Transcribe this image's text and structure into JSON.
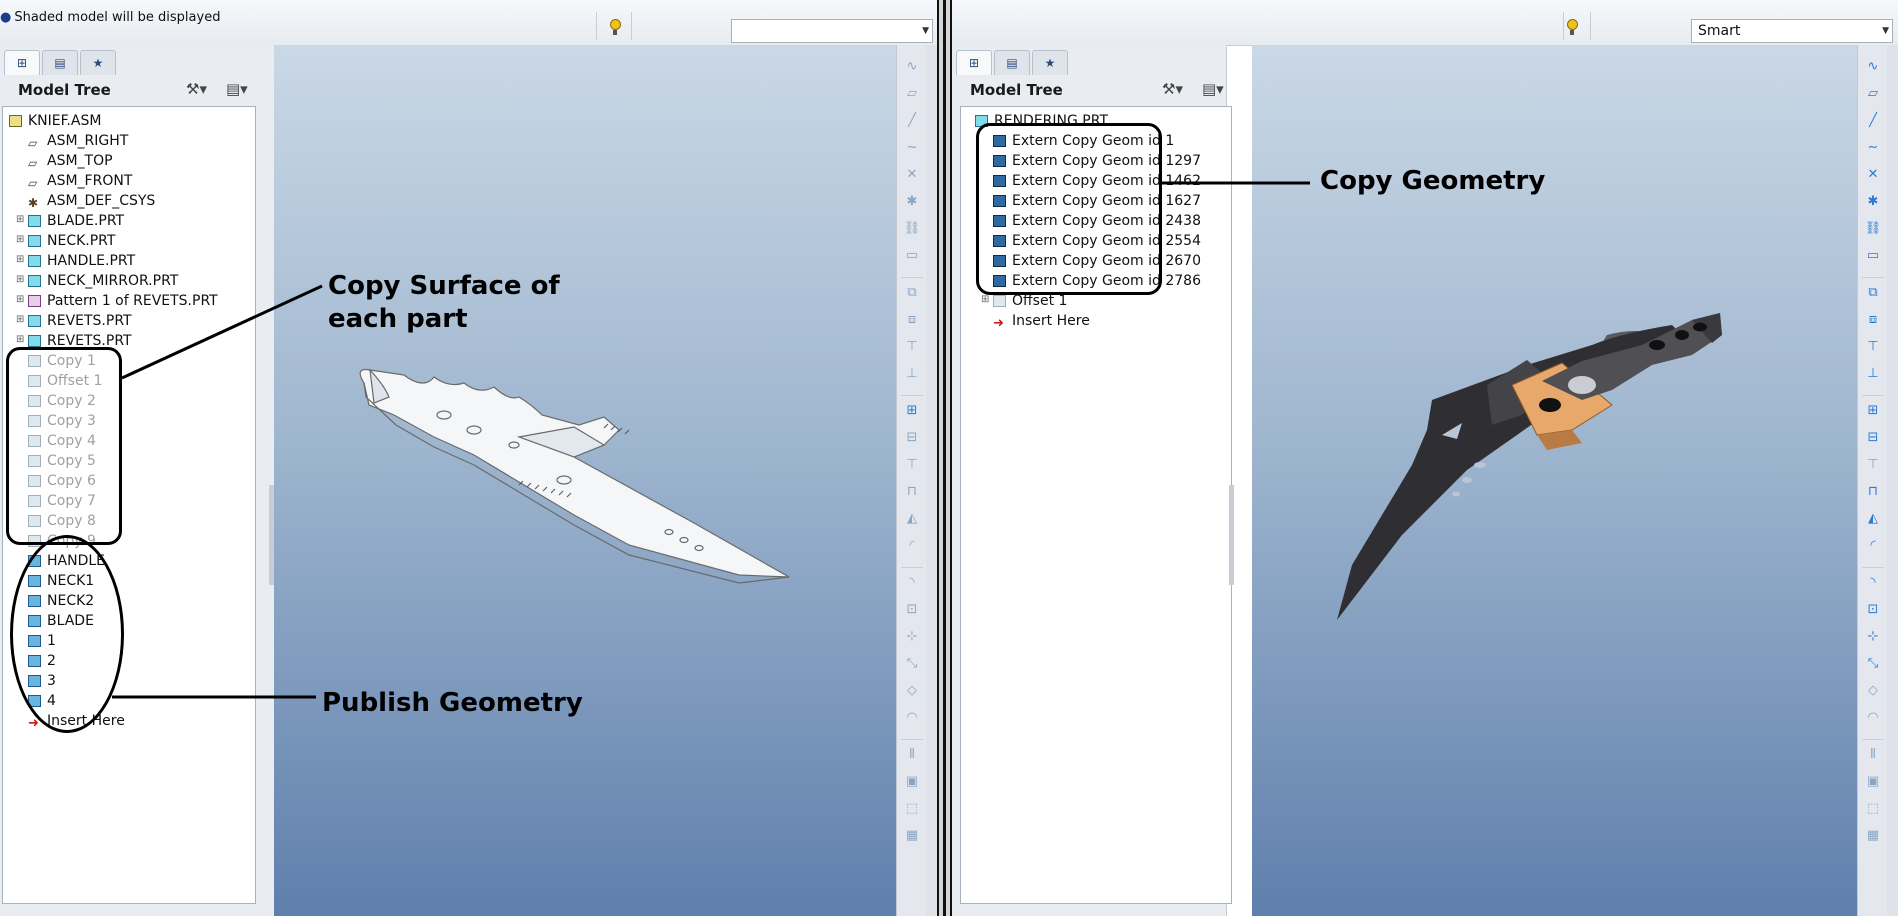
{
  "left": {
    "status_message": "Shaded model will be displayed",
    "display_select_value": "",
    "tree_title": "Model Tree",
    "tree_items": [
      {
        "label": "KNIEF.ASM",
        "icon": "assembly-icon",
        "style": "normal"
      },
      {
        "label": "ASM_RIGHT",
        "icon": "datum-plane-icon",
        "style": "normal"
      },
      {
        "label": "ASM_TOP",
        "icon": "datum-plane-icon",
        "style": "normal"
      },
      {
        "label": "ASM_FRONT",
        "icon": "datum-plane-icon",
        "style": "normal"
      },
      {
        "label": "ASM_DEF_CSYS",
        "icon": "coordinate-system-icon",
        "style": "normal"
      },
      {
        "label": "BLADE.PRT",
        "icon": "part-icon",
        "style": "normal"
      },
      {
        "label": "NECK.PRT",
        "icon": "part-icon",
        "style": "normal"
      },
      {
        "label": "HANDLE.PRT",
        "icon": "part-icon",
        "style": "normal"
      },
      {
        "label": "NECK_MIRROR.PRT",
        "icon": "part-icon",
        "style": "normal"
      },
      {
        "label": "Pattern 1 of REVETS.PRT",
        "icon": "pattern-icon",
        "style": "normal"
      },
      {
        "label": "REVETS.PRT",
        "icon": "part-icon",
        "style": "normal"
      },
      {
        "label": "REVETS.PRT",
        "icon": "part-icon",
        "style": "normal"
      },
      {
        "label": "Copy 1",
        "icon": "copy-surface-icon",
        "style": "grey"
      },
      {
        "label": "Offset 1",
        "icon": "copy-surface-icon",
        "style": "grey"
      },
      {
        "label": "Copy 2",
        "icon": "copy-surface-icon",
        "style": "grey"
      },
      {
        "label": "Copy 3",
        "icon": "copy-surface-icon",
        "style": "grey"
      },
      {
        "label": "Copy 4",
        "icon": "copy-surface-icon",
        "style": "grey"
      },
      {
        "label": "Copy 5",
        "icon": "copy-surface-icon",
        "style": "grey"
      },
      {
        "label": "Copy 6",
        "icon": "copy-surface-icon",
        "style": "grey"
      },
      {
        "label": "Copy 7",
        "icon": "copy-surface-icon",
        "style": "grey"
      },
      {
        "label": "Copy 8",
        "icon": "copy-surface-icon",
        "style": "grey"
      },
      {
        "label": "Copy 9",
        "icon": "copy-surface-icon",
        "style": "grey"
      },
      {
        "label": "HANDLE",
        "icon": "publish-geometry-icon",
        "style": "normal"
      },
      {
        "label": "NECK1",
        "icon": "publish-geometry-icon",
        "style": "normal"
      },
      {
        "label": "NECK2",
        "icon": "publish-geometry-icon",
        "style": "normal"
      },
      {
        "label": "BLADE",
        "icon": "publish-geometry-icon",
        "style": "normal"
      },
      {
        "label": "1",
        "icon": "publish-geometry-icon",
        "style": "normal"
      },
      {
        "label": "2",
        "icon": "publish-geometry-icon",
        "style": "normal"
      },
      {
        "label": "3",
        "icon": "publish-geometry-icon",
        "style": "normal"
      },
      {
        "label": "4",
        "icon": "publish-geometry-icon",
        "style": "normal"
      },
      {
        "label": "Insert Here",
        "icon": "insert-here-arrow-icon",
        "style": "normal"
      }
    ],
    "annotations": {
      "copy_surface_line1": "Copy Surface of",
      "copy_surface_line2": "each part",
      "publish_geometry": "Publish Geometry"
    }
  },
  "right": {
    "display_select_value": "Smart",
    "tree_title": "Model Tree",
    "tree_items": [
      {
        "label": "RENDERING.PRT",
        "icon": "part-icon"
      },
      {
        "label": "Extern Copy Geom id 1",
        "icon": "extern-copy-geom-icon"
      },
      {
        "label": "Extern Copy Geom id 1297",
        "icon": "extern-copy-geom-icon"
      },
      {
        "label": "Extern Copy Geom id 1462",
        "icon": "extern-copy-geom-icon"
      },
      {
        "label": "Extern Copy Geom id 1627",
        "icon": "extern-copy-geom-icon"
      },
      {
        "label": "Extern Copy Geom id 2438",
        "icon": "extern-copy-geom-icon"
      },
      {
        "label": "Extern Copy Geom id 2554",
        "icon": "extern-copy-geom-icon"
      },
      {
        "label": "Extern Copy Geom id 2670",
        "icon": "extern-copy-geom-icon"
      },
      {
        "label": "Extern Copy Geom id 2786",
        "icon": "extern-copy-geom-icon"
      },
      {
        "label": "Offset 1",
        "icon": "offset-icon"
      },
      {
        "label": "Insert Here",
        "icon": "insert-here-arrow-icon"
      }
    ],
    "annotations": {
      "copy_geometry": "Copy Geometry"
    }
  },
  "colors": {
    "viewport_top": "#cad8e6",
    "viewport_bottom": "#5f7fac",
    "knife_blade_dark": "#2f2f33",
    "knife_handle_tan": "#e8a86c"
  }
}
